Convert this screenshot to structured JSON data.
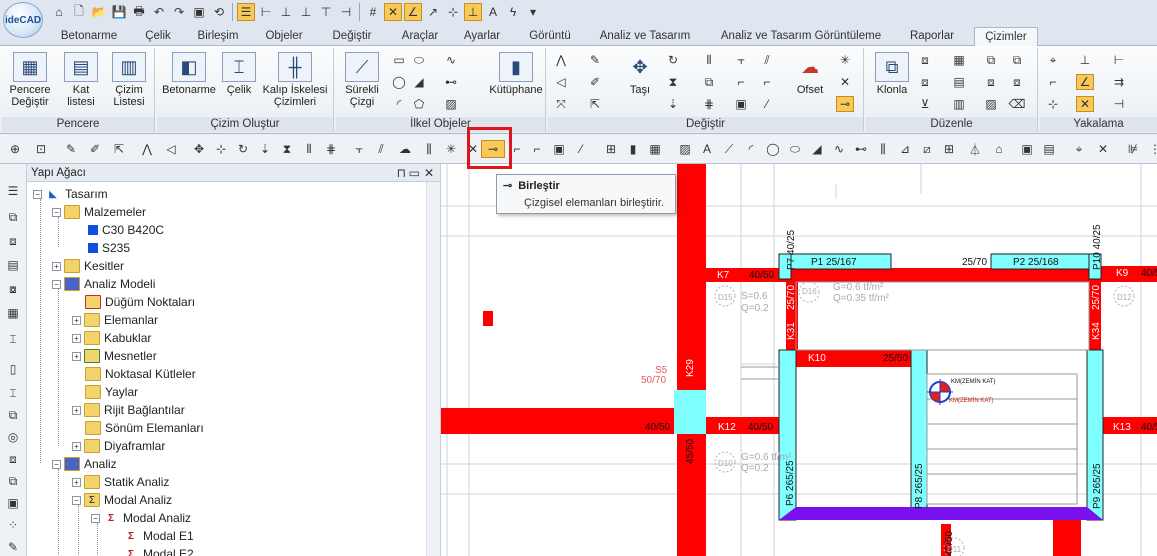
{
  "app": {
    "logo": "ideCAD"
  },
  "menu_tabs": [
    "Betonarme",
    "Çelik",
    "Birleşim",
    "Objeler",
    "Değiştir",
    "Araçlar",
    "Ayarlar",
    "Görüntü",
    "Analiz ve Tasarım",
    "Analiz ve Tasarım Görüntüleme",
    "Raporlar",
    "Çizimler"
  ],
  "active_tab": "Çizimler",
  "ribbon": {
    "groups": {
      "pencere": "Pencere",
      "cizim_olustur": "Çizim Oluştur",
      "ilkel_objeler": "İlkel Objeler",
      "degistir": "Değiştir",
      "duzenle": "Düzenle",
      "yakalama": "Yakalama"
    },
    "buttons": {
      "pencere_degistir": "Pencere Değiştir",
      "kat_listesi": "Kat listesi",
      "cizim_listesi": "Çizim Listesi",
      "betonarme": "Betonarme",
      "celik": "Çelik",
      "kalip_iskelesi": "Kalıp İskelesi Çizimleri",
      "surekli_cizgi": "Sürekli Çizgi",
      "kutuphane": "Kütüphane",
      "tasi": "Taşı",
      "ofset": "Ofset",
      "klonla": "Klonla"
    }
  },
  "tooltip": {
    "title": "Birleştir",
    "description": "Çizgisel elemanları birleştirir."
  },
  "tree": {
    "title": "Yapı Ağacı",
    "nodes": [
      "Tasarım",
      "Malzemeler",
      "C30 B420C",
      "S235",
      "Kesitler",
      "Analiz Modeli",
      "Düğüm Noktaları",
      "Elemanlar",
      "Kabuklar",
      "Mesnetler",
      "Noktasal Kütleler",
      "Yaylar",
      "Rijit Bağlantılar",
      "Sönüm Elemanları",
      "Diyaframlar",
      "Analiz",
      "Statik Analiz",
      "Modal Analiz",
      "Modal Analiz",
      "Modal E1",
      "Modal E2"
    ]
  },
  "drawing": {
    "labels": {
      "k7": "K7",
      "k7d": "40/50",
      "p1": "P1 25/167",
      "k8": "K8",
      "k8d": "25/70",
      "p2": "P2 25/168",
      "k9": "K9",
      "k9d": "40/50",
      "p7": "P7 40/25",
      "p10": "P10 40/25",
      "k31": "K31",
      "k31d": "25/70",
      "k34": "K34",
      "k34d": "25/70",
      "k10": "K10",
      "k10d": "25/50",
      "k29": "K29",
      "s5": "S5",
      "s5d": "50/70",
      "k12": "K12",
      "k12d": "40/50",
      "left4050": "40/50",
      "k13": "K13",
      "k13d": "40/50",
      "p6": "P6 265/25",
      "p8": "P8 265/25",
      "p9": "P9 265/25",
      "col4550a": "45/50",
      "col4550b": "45/50",
      "km1": "KM(ZEMİN KAT)",
      "km2": "KM(ZEMİN KAT)",
      "slab1": "G=0.6 tf/m²",
      "slab2": "Q=0.35 tf/m²",
      "d15": "D15",
      "d16": "D16",
      "d10": "D10",
      "d11": "D11",
      "d12": "D12",
      "s06a": "S=0.6",
      "q02a": "Q=0.2",
      "g06b": "G=0.6 tf/m²",
      "q02b": "Q=0.2"
    }
  },
  "colors": {
    "beam_red": "#ff0000",
    "slab_cyan": "#7fffff",
    "purple": "#7a10ee",
    "highlight": "#f8c957",
    "callout": "#e0141b"
  }
}
